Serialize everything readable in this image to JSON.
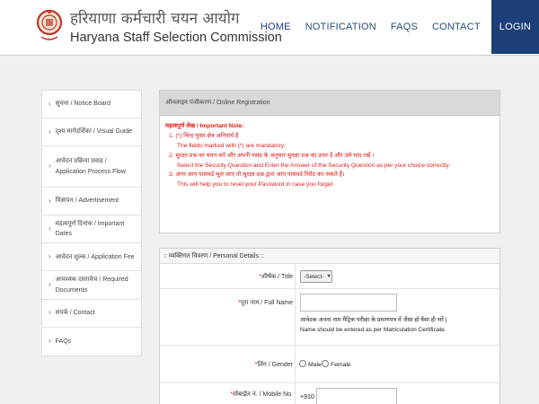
{
  "header": {
    "title_hindi": "हरियाणा कर्मचारी चयन आयोग",
    "title_english": "Haryana Staff Selection Commission",
    "logo_icon": "hssc-emblem-icon",
    "nav": [
      {
        "label": "HOME"
      },
      {
        "label": "NOTIFICATION"
      },
      {
        "label": "FAQS"
      },
      {
        "label": "CONTACT"
      },
      {
        "label": "LOGIN"
      }
    ]
  },
  "sidebar": {
    "items": [
      {
        "label": "सूचना / Notice Board"
      },
      {
        "label": "दृश्य मार्गदर्शिका / Visual Guide"
      },
      {
        "label": "आवेदन प्रक्रिया प्रवाह / Application Process Flow"
      },
      {
        "label": "विज्ञापन / Advertisement"
      },
      {
        "label": "महत्वपूर्ण दिनांक / Important Dates"
      },
      {
        "label": "आवेदन शुल्क / Application Fee"
      },
      {
        "label": "आवश्यक दस्तावेज / Required Documents"
      },
      {
        "label": "संपर्क / Contact"
      },
      {
        "label": "FAQs"
      }
    ]
  },
  "registration": {
    "heading": "ऑनलाइन पंजीकरण / Online Registration",
    "note_title": "महत्वपूर्ण लेख / Important Note:",
    "notes": [
      "1. (*) चिन्ह युक्त क्षेत्र अनिवार्य है",
      "The fields marked with (*) are mandatory.",
      "2. सुरक्षा प्रश्न का चयन करें और अपनी पसंद के अनुसार सुरक्षा प्रश्न का उत्तर दें और उसे याद रखें ।",
      "Select the Security Question and Enter the Answer of the Security Question as per your choice correctly.",
      "3. अगर आप पासवर्ड भूल जाए तो सुरक्षा प्रश्न द्वारा आप पासवर्ड रिसेट कर सकते हैं।",
      "This will help you to reset your Password in case you forget."
    ]
  },
  "personal": {
    "heading": ":: व्यक्तिगत विवरण / Personal Details ::",
    "title_label": "शीर्षक / Title",
    "title_select": "-Select-",
    "name_label": "पूरा नाम / Full Name",
    "name_value": "",
    "name_helper_hindi": "आवेदक अपना नाम मैट्रिक परीक्षा के प्रमाणपत्र में जैसा हो वैसा ही भरें |",
    "name_helper_en": "Name should be entered as per Matriculation Certificate.",
    "gender_label": "लिंग / Gender",
    "gender_options": [
      "Male",
      "Female"
    ],
    "mobile_label": "मोबाईल नं. / Mobile No.",
    "mobile_prefix": "+91",
    "mobile_value": "0"
  },
  "colors": {
    "nav_blue": "#1c3f7a",
    "note_red": "#e21a1a",
    "band_grey": "#f0f0f0"
  }
}
